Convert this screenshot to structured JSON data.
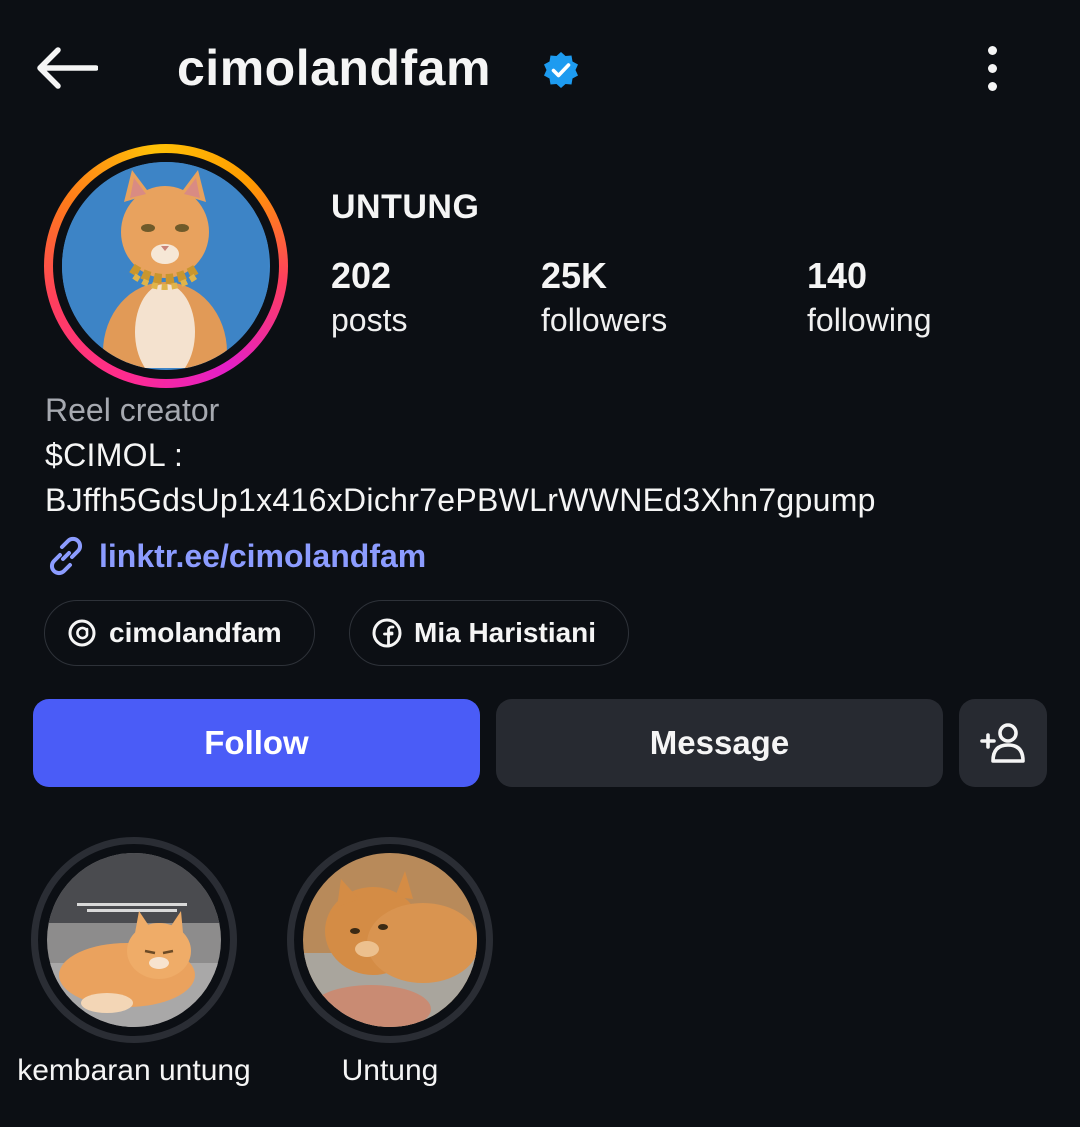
{
  "header": {
    "username": "cimolandfam",
    "verified_icon": "verified-badge-icon",
    "back_icon": "arrow-left-icon",
    "more_icon": "more-vertical-icon"
  },
  "profile": {
    "display_name": "UNTUNG",
    "stats": [
      {
        "value": "202",
        "label": "posts"
      },
      {
        "value": "25K",
        "label": "followers"
      },
      {
        "value": "140",
        "label": "following"
      }
    ],
    "category": "Reel creator",
    "bio_line_1": "$CIMOL :",
    "bio_line_2": "BJffh5GdsUp1x416xDichr7ePBWLrWWNEd3Xhn7gpump",
    "link": "linktr.ee/cimolandfam"
  },
  "chips": [
    {
      "label": "cimolandfam",
      "icon": "threads-icon"
    },
    {
      "label": "Mia Haristiani",
      "icon": "facebook-icon"
    }
  ],
  "actions": {
    "follow": "Follow",
    "message": "Message",
    "add_user_icon": "add-user-icon"
  },
  "highlights": [
    {
      "label": "kembaran untung"
    },
    {
      "label": "Untung"
    }
  ],
  "colors": {
    "background": "#0c0f14",
    "follow_button": "#4a5cf7",
    "secondary_button": "#272a31",
    "link": "#8c9cff",
    "verified": "#1d9bf0"
  }
}
